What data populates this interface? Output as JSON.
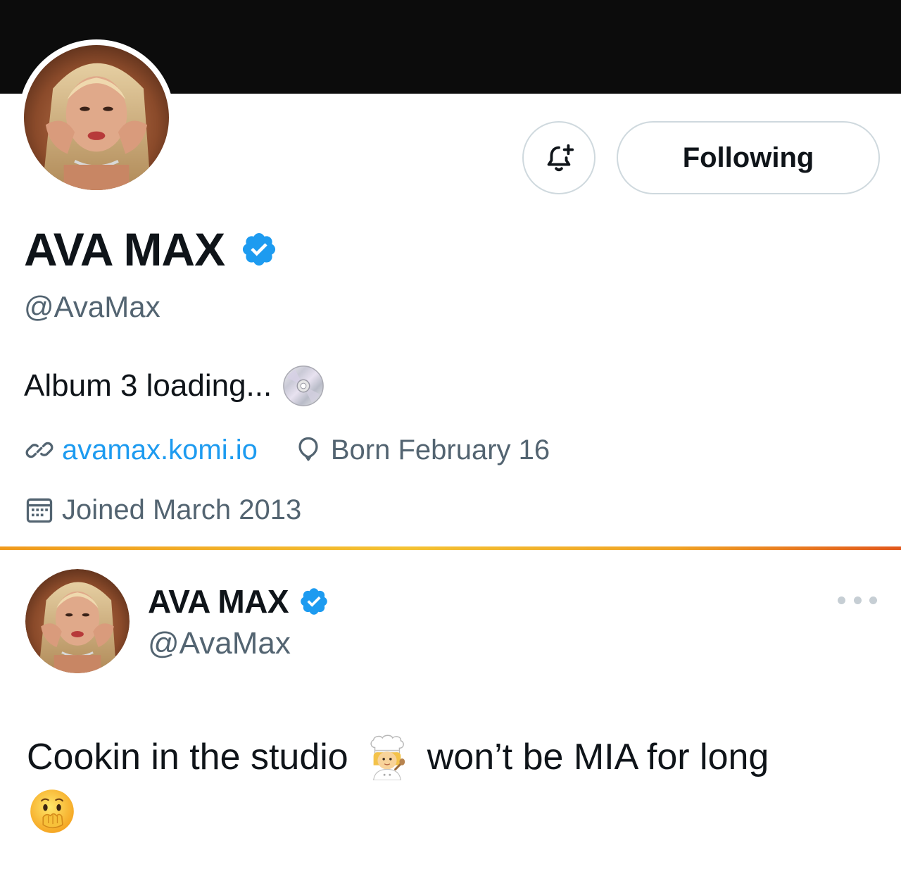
{
  "profile": {
    "display_name": "AVA MAX",
    "handle": "@AvaMax",
    "bio": "Album 3 loading...",
    "website": "avamax.komi.io",
    "birthday": "Born February 16",
    "joined": "Joined March 2013",
    "following_label": "Following",
    "verified": true
  },
  "tweet": {
    "display_name": "AVA MAX",
    "handle": "@AvaMax",
    "text_part1": "Cookin in the studio",
    "text_part2": "won’t be MIA for long"
  },
  "icons": {
    "bio_emoji": "cd-disc-icon",
    "tweet_emoji_1": "woman-cook-emoji",
    "tweet_emoji_2": "face-with-hand-over-mouth-emoji",
    "notify": "bell-plus-icon",
    "link": "link-icon",
    "birthday": "balloon-icon",
    "joined": "calendar-icon",
    "more": "more-dots-icon"
  },
  "colors": {
    "verified_blue": "#1d9bf0",
    "link_blue": "#1d9bf0",
    "secondary_text": "#536471",
    "banner": "#0c0c0c"
  }
}
